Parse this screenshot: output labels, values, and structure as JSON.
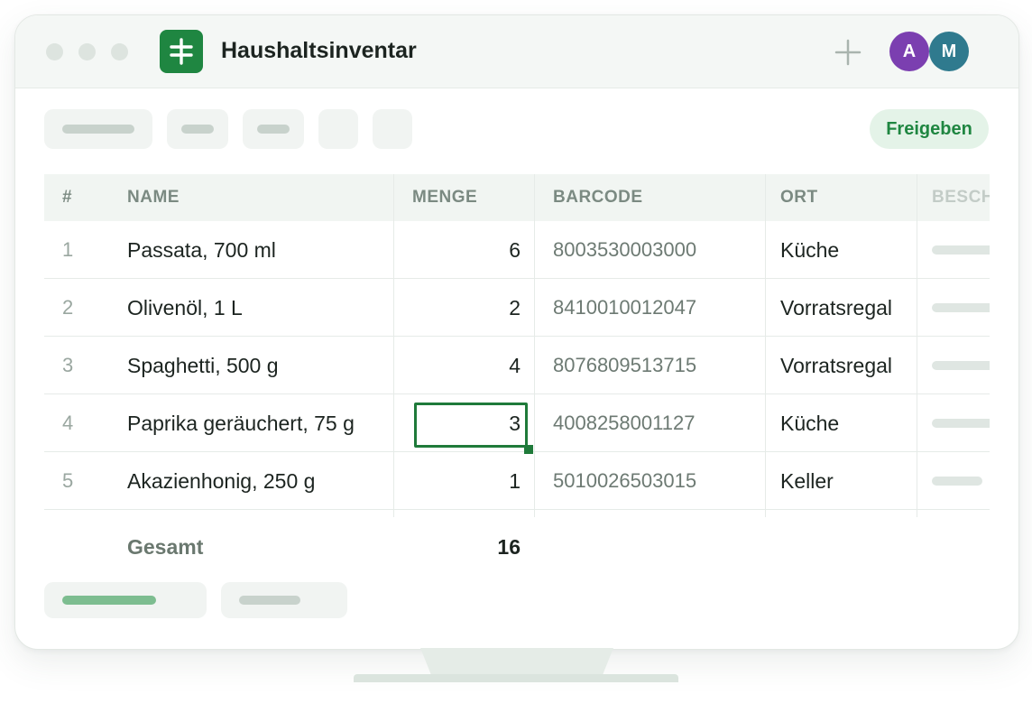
{
  "app": {
    "title": "Haushaltsinventar",
    "accent_color": "#1f8641",
    "icon": "spreadsheet-icon"
  },
  "titlebar": {
    "add_icon": "plus-icon",
    "avatars": [
      {
        "initial": "A",
        "color": "#7b3fb0"
      },
      {
        "initial": "M",
        "color": "#2f7a8e"
      }
    ]
  },
  "toolbar": {
    "share_label": "Freigeben"
  },
  "table": {
    "columns": [
      "#",
      "NAME",
      "MENGE",
      "BARCODE",
      "ORT",
      "BESCH"
    ],
    "rows": [
      {
        "index": "1",
        "name": "Passata, 700 ml",
        "quantity": "6",
        "barcode": "8003530003000",
        "location": "Küche"
      },
      {
        "index": "2",
        "name": "Olivenöl, 1 L",
        "quantity": "2",
        "barcode": "8410010012047",
        "location": "Vorratsregal"
      },
      {
        "index": "3",
        "name": "Spaghetti, 500 g",
        "quantity": "4",
        "barcode": "8076809513715",
        "location": "Vorratsregal"
      },
      {
        "index": "4",
        "name": "Paprika geräuchert, 75 g",
        "quantity": "3",
        "barcode": "4008258001127",
        "location": "Küche"
      },
      {
        "index": "5",
        "name": "Akazienhonig, 250 g",
        "quantity": "1",
        "barcode": "5010026503015",
        "location": "Keller"
      }
    ],
    "selected_cell": {
      "row": "4",
      "column": "MENGE"
    },
    "total_label": "Gesamt",
    "total_value": "16"
  }
}
